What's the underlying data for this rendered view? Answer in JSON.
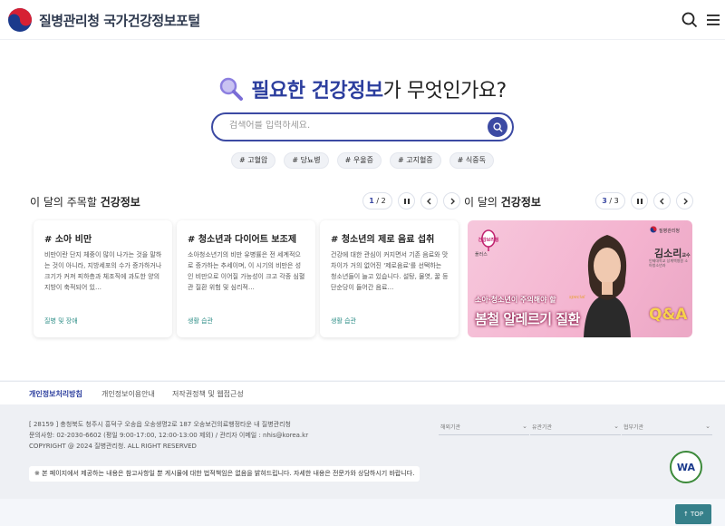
{
  "header": {
    "logo_text": "질병관리청 국가건강정보포털"
  },
  "hero": {
    "title_emphasis": "필요한 건강정보",
    "title_rest": "가 무엇인가요?",
    "search_placeholder": "검색어를 입력하세요.",
    "tags": [
      "# 고혈압",
      "# 당뇨병",
      "# 우울증",
      "# 고지혈증",
      "# 식중독"
    ]
  },
  "left_section": {
    "title_prefix": "이 달의 주목할 ",
    "title_bold": "건강정보",
    "pager": {
      "current": "1",
      "total": "/ 2"
    }
  },
  "right_section": {
    "title_prefix": "이 달의 ",
    "title_bold": "건강정보",
    "pager": {
      "current": "3",
      "total": "/ 3"
    }
  },
  "cards": [
    {
      "title": "# 소아 비만",
      "desc": "비만이란 단지 체중이 많이 나가는 것을 말하는 것이 아니라, 지방세포의 수가 증가하거나 크기가 커져 피하층과 체조직에 과도한 양의 지방이 축적되어 있…",
      "category": "질병 및 장애"
    },
    {
      "title": "# 청소년과 다이어트 보조제",
      "desc": "소아청소년기의 비만 유병률은 전 세계적으로 증가하는 추세이며, 이 시기의 비만은 성인 비만으로 이어질 가능성이 크고 각종 심혈관 질환 위험 및 심리적…",
      "category": "생활 습관"
    },
    {
      "title": "# 청소년의 제로 음료 섭취",
      "desc": "건강에 대한 관심이 커지면서 기존 음료와 맛 차이가 거의 없어진 '제로음료'를 선택하는 청소년들이 늘고 있습니다. 설탕, 물엿, 꿀 등 단순당이 들어간 음료…",
      "category": "생활 습관"
    }
  ],
  "banner": {
    "badge": "건강브리핑",
    "badge_plus": "플러스",
    "org": "질병관리청",
    "name": "김소리",
    "name_suffix": "교수",
    "name_sub": "인제대학교 상계백병원 소아청소년과",
    "line1": "소아·청소년이 주의해야 할",
    "line2": "봄철 알레르기 질환",
    "qa": "Q&A",
    "special": "special"
  },
  "footer": {
    "links": [
      "개인정보처리방침",
      "개인정보이용안내",
      "저작권정책 및 웹접근성"
    ],
    "address": "[ 28159 ] 충청북도 청주시 흥덕구 오송읍 오송생명2로 187 오송보건의료행정타운 내 질병관리청",
    "contact": "문의사항: 02-2030-6602 (평일 9:00-17:00, 12:00-13:00 제외) / 관리자 이메일 : nhis@korea.kr",
    "copyright": "COPYRIGHT @ 2024 질병관리청. ALL RIGHT RESERVED",
    "selects": [
      "해외기관",
      "유관기관",
      "협부기관"
    ],
    "notice": "※ 본 페이지에서 제공하는 내용은 참고사항일 뿐 게시물에 대한 법적책임은 없음을 밝혀드립니다. 자세한 내용은 전문가와 상담하시기 바랍니다.",
    "wa_label": "WA"
  },
  "top_button": "↑ TOP",
  "colors": {
    "brand": "#2c3e9e",
    "accent_teal": "#36808a",
    "category": "#2f8f88"
  }
}
